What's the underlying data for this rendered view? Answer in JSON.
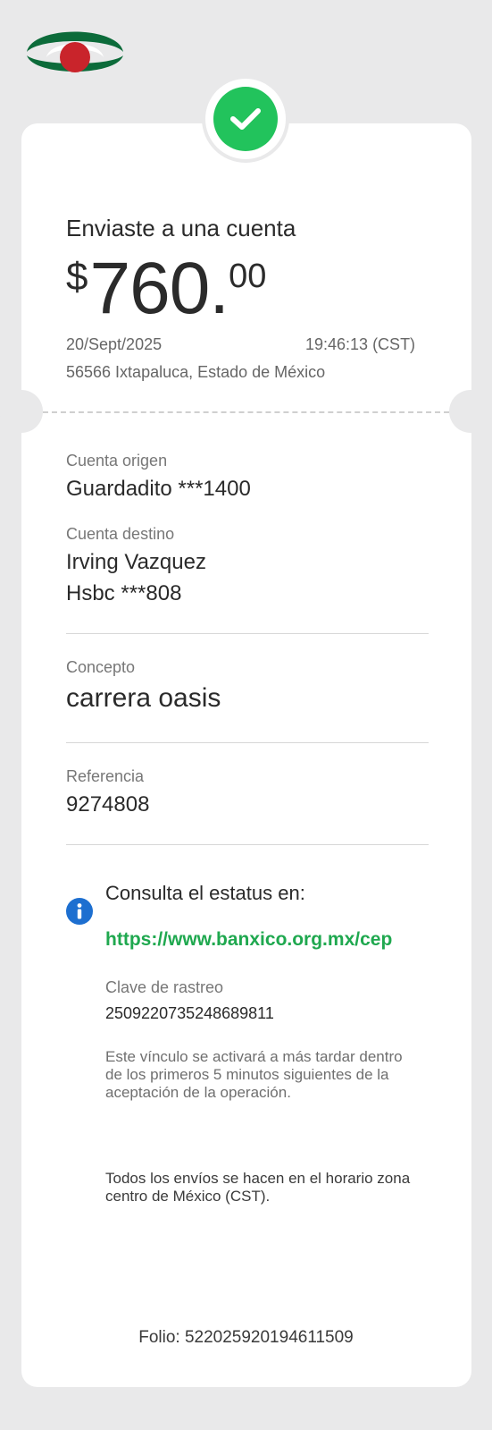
{
  "header": {
    "logo_icon": "banco-azteca-logo",
    "status_icon": "check-circle-icon"
  },
  "receipt": {
    "title": "Enviaste a una cuenta",
    "amount": {
      "currency": "$",
      "integer": "760.",
      "cents": "00"
    },
    "date": "20/Sept/2025",
    "time": "19:46:13 (CST)",
    "location": "56566 Ixtapaluca, Estado de México"
  },
  "details": {
    "origin_label": "Cuenta origen",
    "origin_value": "Guardadito ***1400",
    "destination_label": "Cuenta destino",
    "destination_name": "Irving Vazquez",
    "destination_account": "Hsbc ***808",
    "concept_label": "Concepto",
    "concept_value": "carrera oasis",
    "reference_label": "Referencia",
    "reference_value": "9274808"
  },
  "status": {
    "info_icon": "info-icon",
    "prompt": "Consulta el estatus en:",
    "link": "https://www.banxico.org.mx/cep",
    "tracking_label": "Clave de rastreo",
    "tracking_value": "2509220735248689811",
    "activation_note": "Este vínculo se activará a más tardar dentro de los primeros 5 minutos siguientes de la aceptación de la operación.",
    "timezone_note": "Todos los envíos se hacen en el horario zona centro de México (CST)."
  },
  "footer": {
    "folio": "Folio: 522025920194611509"
  },
  "colors": {
    "background": "#e9e9ea",
    "card": "#ffffff",
    "success_green": "#22c35c",
    "link_green": "#1fa84f",
    "info_blue": "#1d6fd0",
    "logo_green": "#0c6b3a",
    "logo_red": "#c9242b"
  }
}
